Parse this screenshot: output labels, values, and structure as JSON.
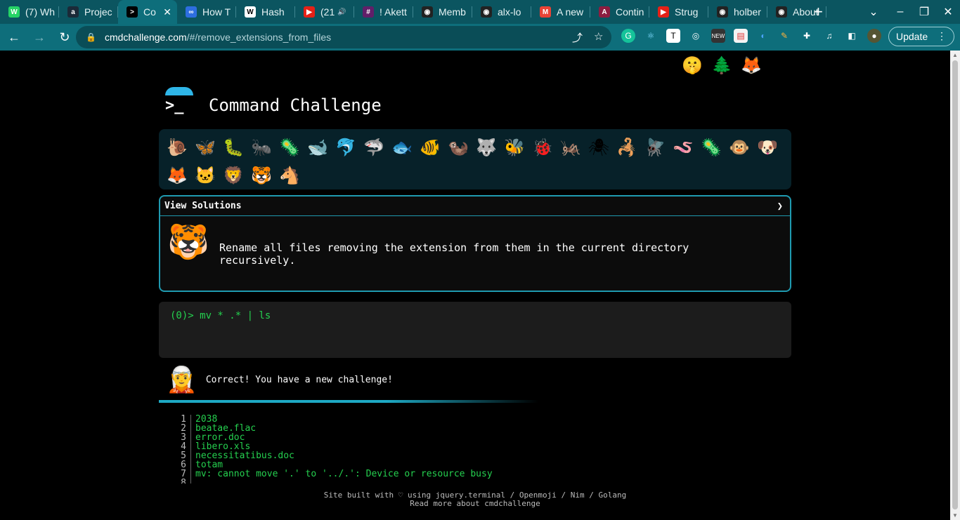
{
  "browser": {
    "tabs": [
      {
        "label": "(7) Wh",
        "icon": "whatsapp-icon",
        "color": "#25d366",
        "glyph": "W"
      },
      {
        "label": "Projec",
        "icon": "alx-icon",
        "color": "#1b2a38",
        "glyph": "a"
      },
      {
        "label": "Co",
        "icon": "terminal-icon",
        "color": "#000000",
        "glyph": ">",
        "active": true
      },
      {
        "label": "How T",
        "icon": "loop-icon",
        "color": "#2d6ee0",
        "glyph": "∞"
      },
      {
        "label": "Hash",
        "icon": "wikipedia-icon",
        "color": "#ffffff",
        "glyph": "W"
      },
      {
        "label": "(21",
        "icon": "youtube-icon",
        "color": "#e62117",
        "glyph": "▶",
        "audio": true
      },
      {
        "label": "! Akett",
        "icon": "slack-icon",
        "color": "#611f69",
        "glyph": "#"
      },
      {
        "label": "Memb",
        "icon": "github-icon",
        "color": "#222222",
        "glyph": "◉"
      },
      {
        "label": "alx-lo",
        "icon": "github-icon",
        "color": "#222222",
        "glyph": "◉"
      },
      {
        "label": "A new",
        "icon": "gmail-icon",
        "color": "#ea4335",
        "glyph": "M"
      },
      {
        "label": "Contin",
        "icon": "asu-icon",
        "color": "#8c1d40",
        "glyph": "A"
      },
      {
        "label": "Strug",
        "icon": "youtube-icon",
        "color": "#e62117",
        "glyph": "▶"
      },
      {
        "label": "holber",
        "icon": "github-icon",
        "color": "#222222",
        "glyph": "◉"
      },
      {
        "label": "About",
        "icon": "github-icon",
        "color": "#222222",
        "glyph": "◉"
      }
    ],
    "new_tab": "+",
    "url_host": "cmdchallenge.com",
    "url_path": "/#/remove_extensions_from_files",
    "update_label": "Update"
  },
  "header": {
    "title": "Command Challenge",
    "logo_prompt": ">_",
    "top_icons": [
      {
        "name": "terminal-logo-icon",
        "glyph": "⌨"
      },
      {
        "name": "shushing-face-icon",
        "glyph": "🤫"
      },
      {
        "name": "christmas-tree-icon",
        "glyph": "🌲"
      },
      {
        "name": "gitlab-icon",
        "glyph": "🦊"
      },
      {
        "name": "mail-icon",
        "glyph": "✉"
      }
    ]
  },
  "emoji_bar": [
    {
      "name": "snail-icon",
      "glyph": "🐌"
    },
    {
      "name": "butterfly-icon",
      "glyph": "🦋"
    },
    {
      "name": "caterpillar-icon",
      "glyph": "🐛"
    },
    {
      "name": "ant-icon",
      "glyph": "🐜"
    },
    {
      "name": "microbe-icon",
      "glyph": "🦠"
    },
    {
      "name": "whale-icon",
      "glyph": "🐋"
    },
    {
      "name": "dolphin-icon",
      "glyph": "🐬"
    },
    {
      "name": "shark-icon",
      "glyph": "🦈"
    },
    {
      "name": "fish-icon",
      "glyph": "🐟"
    },
    {
      "name": "tropical-fish-icon",
      "glyph": "🐠"
    },
    {
      "name": "otter-icon",
      "glyph": "🦦"
    },
    {
      "name": "wolf-icon",
      "glyph": "🐺"
    },
    {
      "name": "bee-icon",
      "glyph": "🐝"
    },
    {
      "name": "ladybug-icon",
      "glyph": "🐞"
    },
    {
      "name": "cricket-icon",
      "glyph": "🦗"
    },
    {
      "name": "spider-icon",
      "glyph": "🕷"
    },
    {
      "name": "scorpion-icon",
      "glyph": "🦂"
    },
    {
      "name": "fly-icon",
      "glyph": "🪰"
    },
    {
      "name": "worm-icon",
      "glyph": "🪱"
    },
    {
      "name": "amoeba-icon",
      "glyph": "🦠"
    },
    {
      "name": "monkey-icon",
      "glyph": "🐵"
    },
    {
      "name": "dog-icon",
      "glyph": "🐶"
    },
    {
      "name": "fox-icon",
      "glyph": "🦊"
    },
    {
      "name": "cat-icon",
      "glyph": "🐱"
    },
    {
      "name": "lion-icon",
      "glyph": "🦁"
    },
    {
      "name": "tiger-icon",
      "glyph": "🐯"
    },
    {
      "name": "horse-icon",
      "glyph": "🐴"
    }
  ],
  "solutions": {
    "header": "View Solutions",
    "chevron": "❯",
    "challenge_icon": "🐯",
    "description": "Rename all files removing the extension from them in the current directory recursively."
  },
  "terminal": {
    "prompt_line": "(0)> mv * .* | ls"
  },
  "result": {
    "bot_icon": "🧝",
    "message": "Correct! You have a new challenge!"
  },
  "output_lines": [
    {
      "n": "1",
      "text": "2038"
    },
    {
      "n": "2",
      "text": "beatae.flac"
    },
    {
      "n": "3",
      "text": "error.doc"
    },
    {
      "n": "4",
      "text": "libero.xls"
    },
    {
      "n": "5",
      "text": "necessitatibus.doc"
    },
    {
      "n": "6",
      "text": "totam"
    },
    {
      "n": "7",
      "text": "mv: cannot move '.' to '../.': Device or resource busy"
    },
    {
      "n": "8",
      "text": ""
    }
  ],
  "footer": {
    "line1": "Site built with ♡ using jquery.terminal / Openmoji / Nim / Golang",
    "line2": "Read more about cmdchallenge"
  },
  "colors": {
    "tabbar": "#0b5560",
    "toolbar": "#0e6e7b",
    "accent": "#1f9ab0",
    "terminal_green": "#25d04f"
  }
}
